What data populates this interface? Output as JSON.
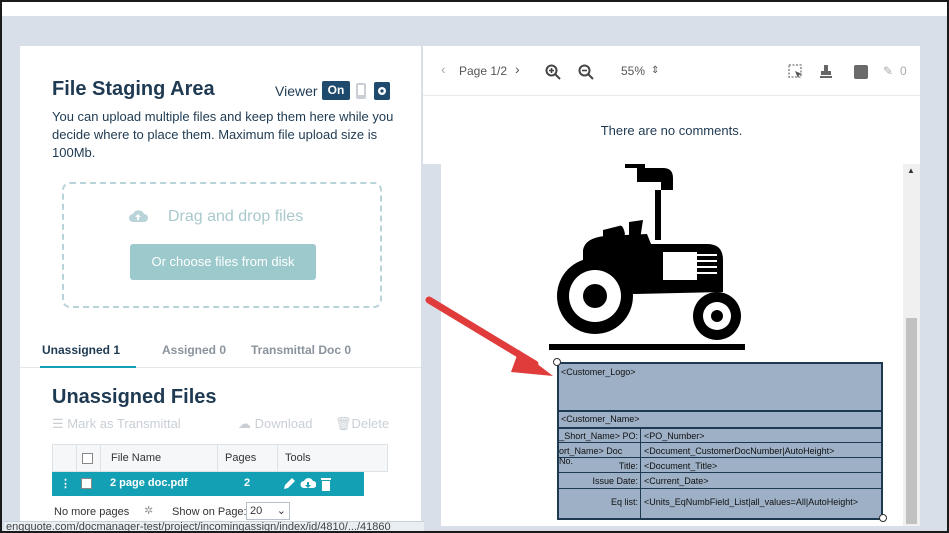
{
  "staging": {
    "title": "File Staging Area",
    "viewer_label": "Viewer",
    "viewer_toggle": "On",
    "description": "You can upload multiple files and keep them here while you decide where to place them. Maximum file upload size is 100Mb.",
    "drop_text": "Drag and drop files",
    "choose_button": "Or choose files from disk"
  },
  "tabs": [
    {
      "label": "Unassigned 1"
    },
    {
      "label": "Assigned 0"
    },
    {
      "label": "Transmittal Doc 0"
    }
  ],
  "unassigned": {
    "title": "Unassigned Files",
    "mark_label": "Mark as Transmittal",
    "download_label": "Download",
    "delete_label": "Delete"
  },
  "table": {
    "headers": {
      "file_name": "File Name",
      "pages": "Pages",
      "tools": "Tools"
    },
    "rows": [
      {
        "file_name": "2 page doc.pdf",
        "pages": "2"
      }
    ],
    "no_more": "No more pages",
    "show_on_page": "Show on Page:",
    "page_size": "20"
  },
  "viewer": {
    "page": "Page 1/2",
    "zoom": "55%",
    "comment_count": "0",
    "no_comments": "There are no comments."
  },
  "form": {
    "logo": "<Customer_Logo>",
    "name": "<Customer_Name>",
    "rows": [
      {
        "label": "_Short_Name> PO:",
        "value": "<PO_Number>"
      },
      {
        "label": "ort_Name> Doc No.",
        "value": "<Document_CustomerDocNumber|AutoHeight>"
      },
      {
        "label": "Title:",
        "value": "<Document_Title>"
      },
      {
        "label": "Issue Date:",
        "value": "<Current_Date>"
      },
      {
        "label": "Eq list:",
        "value": "<Units_EqNumbField_List|all_values=All|AutoHeight>"
      }
    ]
  },
  "status_url": "engquote.com/docmanager-test/project/incomingassign/index/id/4810/.../41860",
  "colors": {
    "accent": "#14a0b4",
    "navy": "#1e4a6e",
    "arrow": "#e03c3c"
  }
}
